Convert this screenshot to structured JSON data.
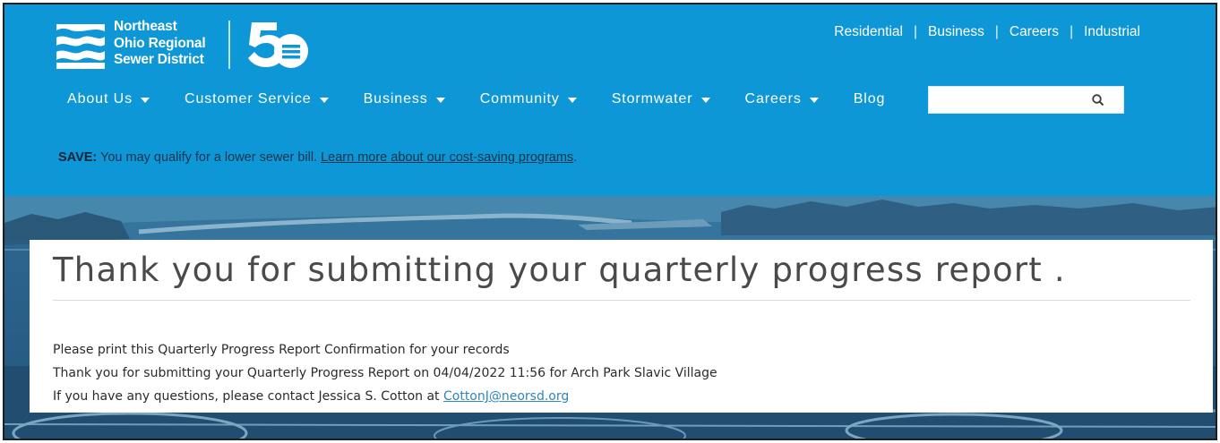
{
  "logo": {
    "line1": "Northeast",
    "line2": "Ohio Regional",
    "line3": "Sewer District",
    "anniversary": "50"
  },
  "utility_nav": [
    "Residential",
    "Business",
    "Careers",
    "Industrial"
  ],
  "utility_separator": "|",
  "main_nav": [
    {
      "label": "About Us",
      "icon": "caret-down-icon"
    },
    {
      "label": "Customer Service",
      "icon": "caret-down-icon"
    },
    {
      "label": "Business",
      "icon": "caret-down-icon"
    },
    {
      "label": "Community",
      "icon": "caret-down-icon"
    },
    {
      "label": "Stormwater",
      "icon": "caret-down-icon"
    },
    {
      "label": "Careers",
      "icon": "caret-down-icon"
    },
    {
      "label": "Blog",
      "icon": null
    }
  ],
  "search": {
    "placeholder": "",
    "value": "",
    "icon": "search-icon"
  },
  "promo": {
    "label": "SAVE:",
    "text": " You may qualify for a lower sewer bill. ",
    "link": "Learn more about our cost-saving programs",
    "trailing": "."
  },
  "confirmation": {
    "title": "Thank you for submitting your quarterly progress report .",
    "line1": "Please print this Quarterly Progress Report Confirmation for your records",
    "line2": "Thank you for submitting your Quarterly Progress Report on 04/04/2022 11:56 for Arch Park Slavic Village",
    "line3_prefix": "If you have any questions, please contact Jessica S. Cotton at ",
    "email": "CottonJ@neorsd.org"
  },
  "colors": {
    "brand_blue": "#0e97d7",
    "promo_text": "#13344a",
    "title_text": "#4a4a4a",
    "link": "#2f86c1"
  }
}
